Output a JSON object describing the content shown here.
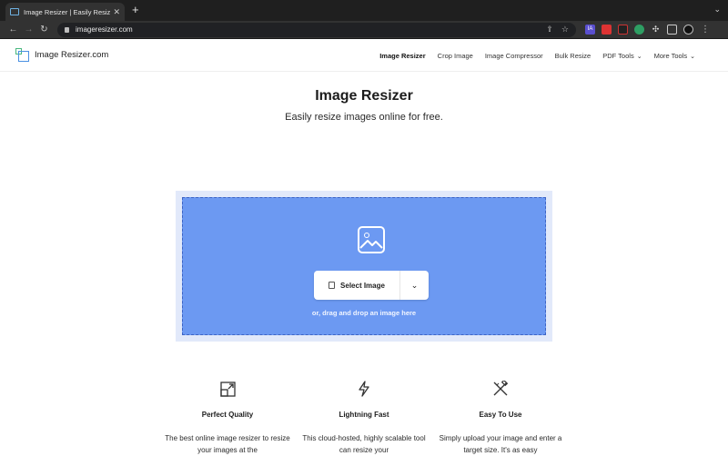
{
  "browser": {
    "tab_title": "Image Resizer | Easily Resize I",
    "tab_close": "✕",
    "new_tab": "+",
    "url": "imageresizer.com"
  },
  "site": {
    "logo_text": "Image Resizer.com",
    "nav": [
      {
        "label": "Image Resizer",
        "active": true
      },
      {
        "label": "Crop Image"
      },
      {
        "label": "Image Compressor"
      },
      {
        "label": "Bulk Resize"
      },
      {
        "label": "PDF Tools",
        "dropdown": true
      },
      {
        "label": "More Tools",
        "dropdown": true
      }
    ]
  },
  "hero": {
    "title": "Image Resizer",
    "subtitle": "Easily resize images online for free."
  },
  "dropzone": {
    "select_label": "Select Image",
    "hint": "or, drag and drop an image here"
  },
  "features": [
    {
      "icon": "resize-icon",
      "title": "Perfect Quality",
      "desc": "The best online image resizer to resize your images at the"
    },
    {
      "icon": "lightning-icon",
      "title": "Lightning Fast",
      "desc": "This cloud-hosted, highly scalable tool can resize your"
    },
    {
      "icon": "pencil-ruler-icon",
      "title": "Easy To Use",
      "desc": "Simply upload your image and enter a target size. It's as easy"
    }
  ],
  "colors": {
    "dropzone": "#6c99f2",
    "dropzone_border": "#3d64c4",
    "dropzone_frame": "#e2e9fa",
    "chrome_dark": "#1f1f1f"
  }
}
